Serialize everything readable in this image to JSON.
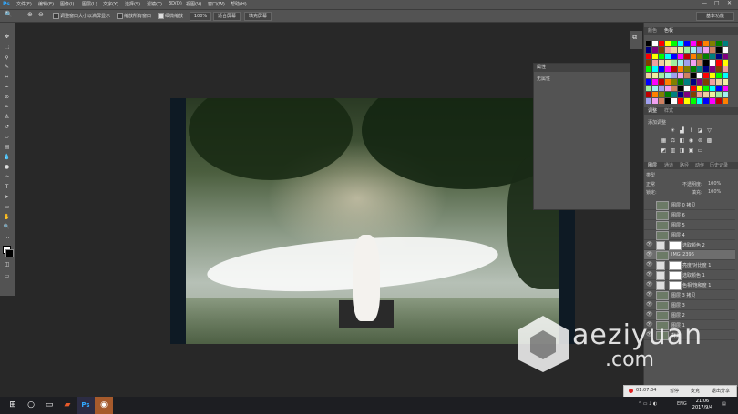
{
  "menubar": {
    "logo": "Ps",
    "items": [
      "文件(F)",
      "编辑(E)",
      "图像(I)",
      "图层(L)",
      "文字(Y)",
      "选择(S)",
      "滤镜(T)",
      "3D(D)",
      "视图(V)",
      "窗口(W)",
      "帮助(H)"
    ],
    "window_controls": [
      "—",
      "□",
      "✕"
    ]
  },
  "options": {
    "resize_label": "调整窗口大小以满屏显示",
    "zoom_all_label": "缩放所有窗口",
    "scrubby_label": "细微缩放",
    "btn_100": "100%",
    "btn_fit": "适合屏幕",
    "btn_fill": "填充屏幕",
    "workspace": "基本功能"
  },
  "properties_panel": {
    "title": "属性",
    "content": "无属性"
  },
  "right_panels": {
    "color_tabs": [
      "颜色",
      "色板"
    ],
    "adjust_tabs": [
      "调整",
      "样式"
    ],
    "adjust_title": "添加调整",
    "layers_tabs": [
      "图层",
      "通道",
      "路径",
      "动作",
      "历史记录"
    ],
    "kind_label": "类型",
    "blend_mode": "正常",
    "opacity_label": "不透明度:",
    "opacity_value": "100%",
    "lock_label": "锁定:",
    "fill_label": "填充:",
    "fill_value": "100%"
  },
  "layers": [
    {
      "name": "图层 0 拷贝",
      "type": "pixel",
      "visible": false,
      "selected": false
    },
    {
      "name": "图层 6",
      "type": "pixel",
      "visible": false,
      "selected": false
    },
    {
      "name": "图层 5",
      "type": "pixel",
      "visible": false,
      "selected": false
    },
    {
      "name": "图层 4",
      "type": "pixel",
      "visible": false,
      "selected": false
    },
    {
      "name": "选取颜色 2",
      "type": "adjust",
      "visible": true,
      "selected": false
    },
    {
      "name": "IMG_2396",
      "type": "pixel",
      "visible": true,
      "selected": true
    },
    {
      "name": "亮度/对比度 1",
      "type": "adjust",
      "visible": true,
      "selected": false
    },
    {
      "name": "选取颜色 1",
      "type": "adjust",
      "visible": true,
      "selected": false
    },
    {
      "name": "色相/饱和度 1",
      "type": "adjust",
      "visible": true,
      "selected": false
    },
    {
      "name": "图层 3 拷贝",
      "type": "pixel",
      "visible": true,
      "selected": false
    },
    {
      "name": "图层 3",
      "type": "pixel",
      "visible": true,
      "selected": false
    },
    {
      "name": "图层 2",
      "type": "pixel",
      "visible": true,
      "selected": false
    },
    {
      "name": "图层 1",
      "type": "pixel",
      "visible": true,
      "selected": false
    },
    {
      "name": "背景",
      "type": "pixel",
      "visible": true,
      "selected": false
    }
  ],
  "watermark": {
    "line1": "aeziyuan",
    "line2": ".com"
  },
  "recording": {
    "time": "01:07:04",
    "pause": "暂停",
    "mic": "麦克",
    "exit": "退出分享"
  },
  "taskbar": {
    "ime": "ENG",
    "time": "21:06",
    "date": "2017/9/4"
  },
  "colors": {
    "accent": "#31a8ff",
    "panel": "#535353",
    "canvas": "#282828",
    "record": "#e02020"
  }
}
